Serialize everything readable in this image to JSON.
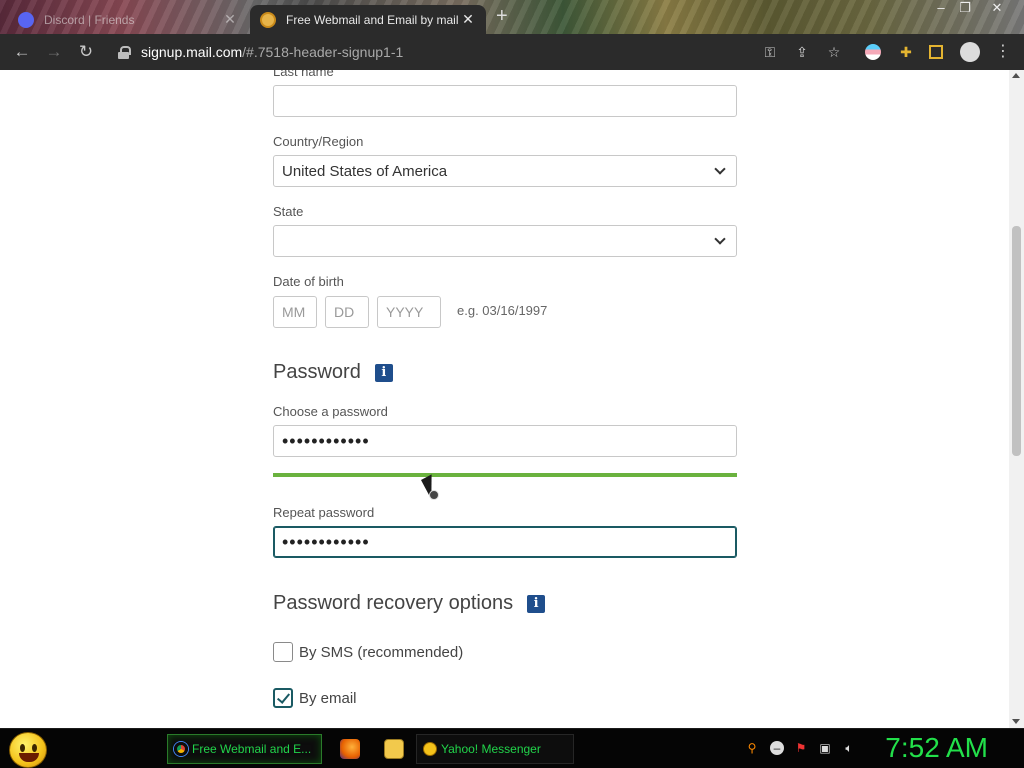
{
  "browser": {
    "tabs": [
      {
        "title": "Discord | Friends",
        "close": "✕",
        "active": false
      },
      {
        "title": "Free Webmail and Email by mail",
        "close": "✕",
        "active": true
      }
    ],
    "new_tab": "+",
    "window_controls": {
      "minimize": "–",
      "maximize": "❐",
      "close": "✕"
    },
    "nav": {
      "back": "←",
      "forward": "→",
      "reload": "↻"
    },
    "url": {
      "host": "signup.mail.com",
      "path": "/#.7518-header-signup1-1"
    },
    "toolbar_icons": [
      "key-icon",
      "share-icon",
      "star-icon",
      "profile-flag-icon",
      "extensions-icon",
      "sidebar-icon",
      "account-icon",
      "menu-icon"
    ]
  },
  "form": {
    "last_name": {
      "label": "Last name",
      "value": ""
    },
    "country": {
      "label": "Country/Region",
      "value": "United States of America"
    },
    "state": {
      "label": "State",
      "value": ""
    },
    "dob": {
      "label": "Date of birth",
      "mm_placeholder": "MM",
      "dd_placeholder": "DD",
      "yyyy_placeholder": "YYYY",
      "hint": "e.g. 03/16/1997"
    },
    "password_section": {
      "title": "Password",
      "info": "i"
    },
    "password": {
      "label": "Choose a password",
      "value": "••••••••••••",
      "strength": 1.0
    },
    "repeat_password": {
      "label": "Repeat password",
      "value": "••••••••••••"
    },
    "recovery_section": {
      "title": "Password recovery options",
      "info": "i"
    },
    "recovery": {
      "sms": {
        "label": "By SMS (recommended)",
        "checked": false
      },
      "email": {
        "label": "By email",
        "checked": true
      }
    }
  },
  "taskbar": {
    "buttons": [
      {
        "label": "Free Webmail and E...",
        "icon": "chrome-icon",
        "active": true
      },
      {
        "label": "Yahoo! Messenger",
        "icon": "yahoo-messenger-icon",
        "active": false
      }
    ],
    "clock": "7:52 AM",
    "colors": {
      "accent": "#22e04a",
      "strength_bar": "#6ab23e",
      "info_icon": "#1f4e8c"
    }
  }
}
